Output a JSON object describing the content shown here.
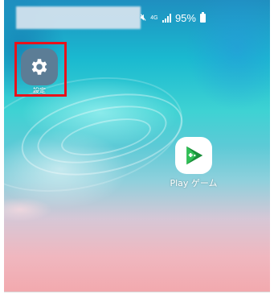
{
  "status_bar": {
    "mute_icon": "mute-icon",
    "network_label": "4G",
    "signal_icon": "signal-icon",
    "battery_percent": "95%",
    "battery_icon": "battery-icon"
  },
  "home_screen": {
    "apps": [
      {
        "label": "設定",
        "icon": "gear-icon",
        "tile_color": "#5c7d96"
      },
      {
        "label": "Play ゲーム",
        "icon": "play-games-icon",
        "tile_color": "#ffffff"
      }
    ]
  },
  "annotation": {
    "color": "#e8121b"
  }
}
